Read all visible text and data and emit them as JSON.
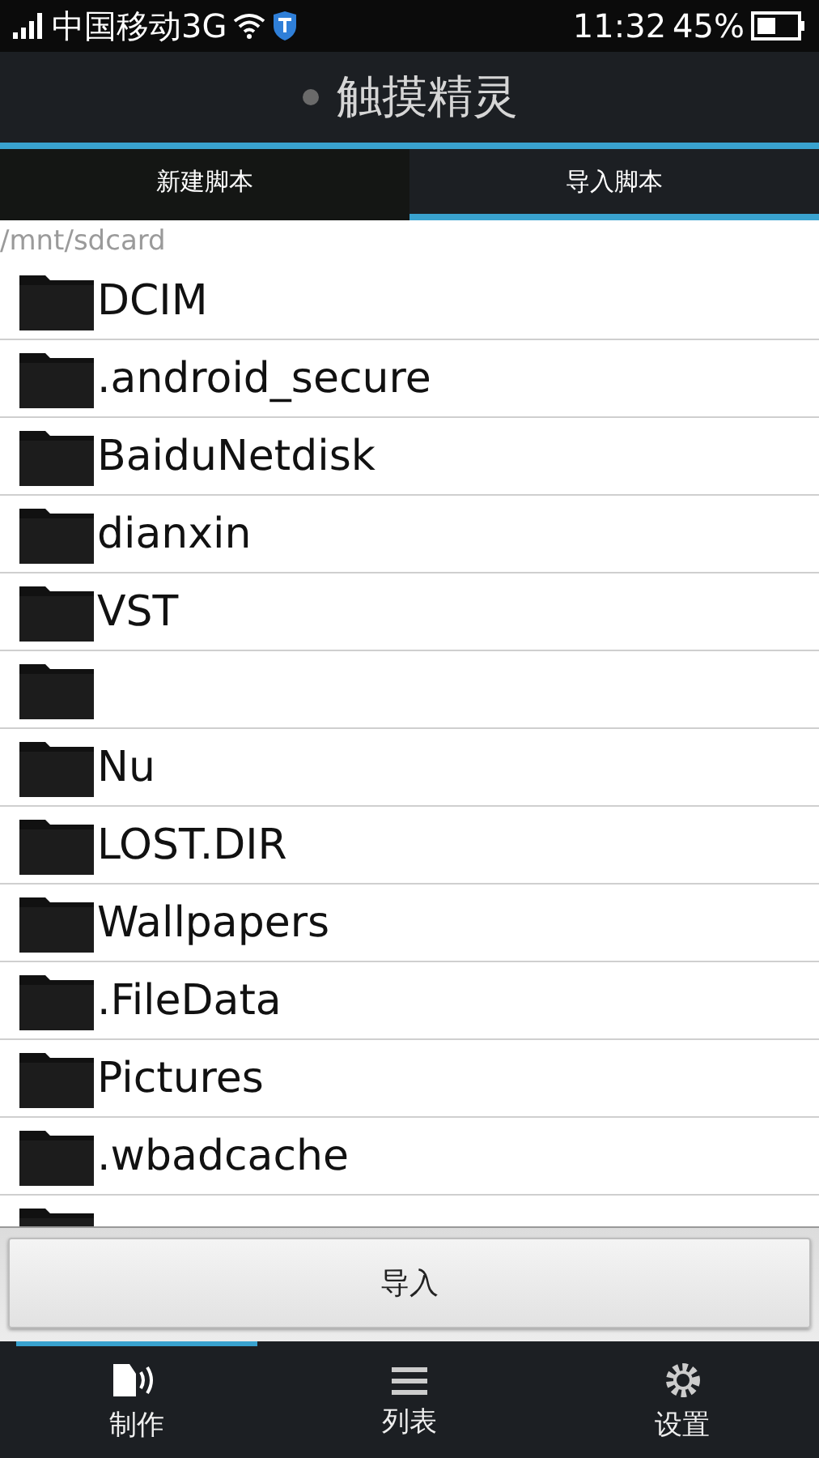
{
  "status_bar": {
    "carrier": "中国移动3G",
    "time": "11:32",
    "battery": "45%"
  },
  "title": "触摸精灵",
  "tabs": [
    {
      "label": "新建脚本",
      "selected": false
    },
    {
      "label": "导入脚本",
      "selected": true
    }
  ],
  "path": "/mnt/sdcard",
  "files": [
    {
      "kind": "folder",
      "name": "DCIM"
    },
    {
      "kind": "folder",
      "name": ".android_secure"
    },
    {
      "kind": "folder",
      "name": "BaiduNetdisk"
    },
    {
      "kind": "folder",
      "name": "dianxin"
    },
    {
      "kind": "folder",
      "name": "VST"
    },
    {
      "kind": "folder"
    },
    {
      "kind": "folder",
      "name": "Nu"
    },
    {
      "kind": "folder",
      "name": "LOST.DIR"
    },
    {
      "kind": "folder",
      "name": "Wallpapers"
    },
    {
      "kind": "folder",
      "name": ".FileData"
    },
    {
      "kind": "folder",
      "name": "Pictures"
    },
    {
      "kind": "folder",
      "name": ".wbadcache"
    },
    {
      "kind": "folder"
    }
  ],
  "import_button": "导入",
  "bottom_nav": [
    {
      "kind": "make",
      "label": "制作",
      "selected": true
    },
    {
      "kind": "list",
      "label": "列表",
      "selected": false
    },
    {
      "kind": "settings",
      "label": "设置",
      "selected": false
    }
  ]
}
